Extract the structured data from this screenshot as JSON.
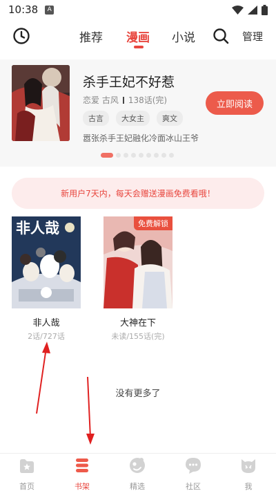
{
  "status_bar": {
    "time": "10:38",
    "badge": "A"
  },
  "top_nav": {
    "tabs": [
      {
        "label": "推荐",
        "active": false
      },
      {
        "label": "漫画",
        "active": true
      },
      {
        "label": "小说",
        "active": false
      }
    ],
    "manage_label": "管理",
    "accent": "#e8473f"
  },
  "banner": {
    "title": "杀手王妃不好惹",
    "genre": "恋爱 古风",
    "chapters": "138话(完)",
    "tags": [
      "古言",
      "大女主",
      "爽文"
    ],
    "description": "嚣张杀手王妃融化冷面冰山王爷",
    "read_button": "立即阅读",
    "carousel_total": 9,
    "carousel_active_index": 0
  },
  "notice": {
    "text": "新用户7天内，每天会赠送漫画免费看哦！"
  },
  "shelf": [
    {
      "name": "非人哉",
      "progress": "2话/727话",
      "badge": "",
      "cover_title": "非人哉"
    },
    {
      "name": "大神在下",
      "progress": "未读/155话(完)",
      "badge": "免费解锁",
      "cover_title": ""
    }
  ],
  "no_more": "没有更多了",
  "bottom_nav": {
    "items": [
      {
        "label": "首页",
        "icon": "home-star-icon",
        "active": false
      },
      {
        "label": "书架",
        "icon": "bookshelf-icon",
        "active": true
      },
      {
        "label": "精选",
        "icon": "featured-icon",
        "active": false
      },
      {
        "label": "社区",
        "icon": "community-chat-icon",
        "active": false
      },
      {
        "label": "我",
        "icon": "profile-cat-icon",
        "active": false
      }
    ]
  }
}
